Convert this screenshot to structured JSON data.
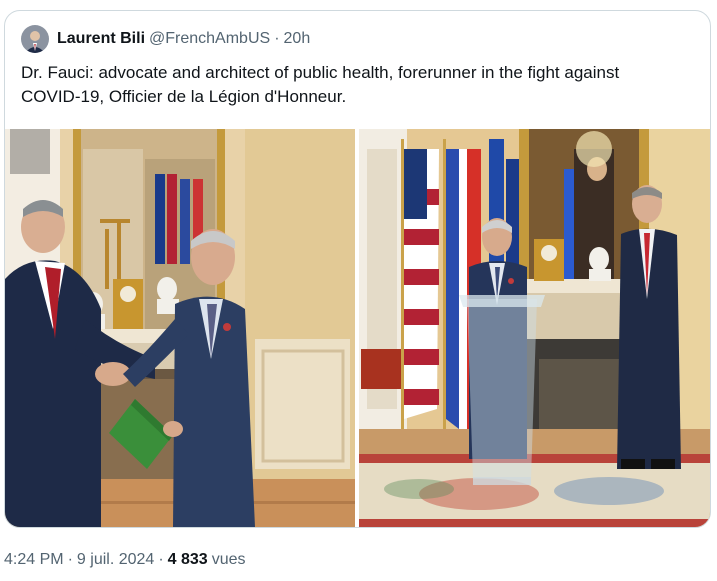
{
  "quoted_post": {
    "author_name": "Laurent Bili",
    "author_handle": "@FrenchAmbUS",
    "separator": "·",
    "time_ago": "20h",
    "text": "Dr. Fauci: advocate and architect of public health, forerunner in the fight against COVID-19, Officier de la Légion d'Honneur.",
    "avatar_icon": "person-avatar-icon"
  },
  "media": {
    "photos": [
      {
        "name": "photo-handshake-medal-ceremony"
      },
      {
        "name": "photo-podium-speech-flags"
      }
    ]
  },
  "post_meta": {
    "time": "4:24 PM",
    "separator": "·",
    "date": "9 juil. 2024",
    "views_count": "4 833",
    "views_label": "vues"
  },
  "colors": {
    "border": "#cfd9de",
    "secondary_text": "#536471",
    "primary_text": "#0f1419"
  }
}
